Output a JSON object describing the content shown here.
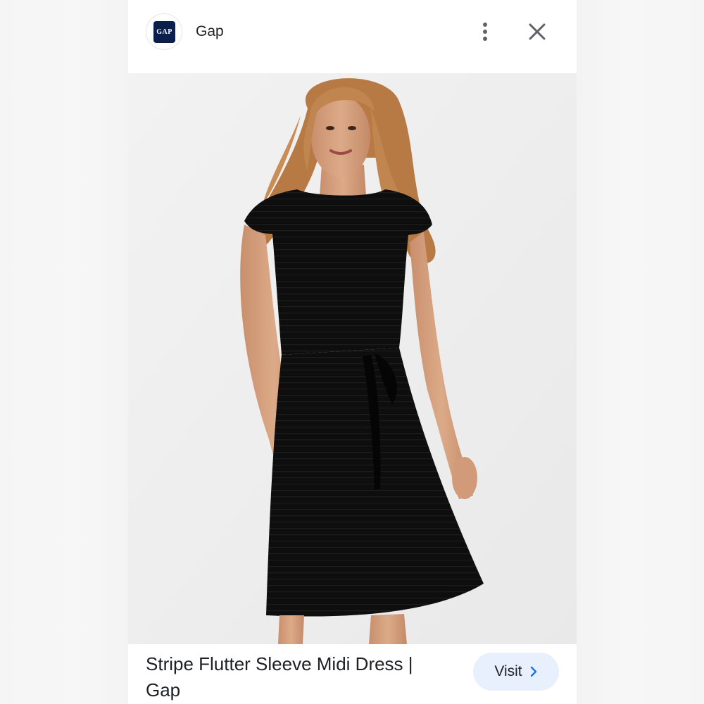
{
  "header": {
    "logo_text": "GAP",
    "site_name": "Gap",
    "more_icon": "more-vert-icon",
    "close_icon": "close-icon"
  },
  "image": {
    "alt": "Stripe Flutter Sleeve Midi Dress | Gap"
  },
  "footer": {
    "title": "Stripe Flutter Sleeve Midi Dress | Gap",
    "visit_label": "Visit",
    "visit_icon": "chevron-right-icon"
  },
  "colors": {
    "logo_bg": "#0b1f4d",
    "visit_bg": "#e8f0fe",
    "accent": "#1a73e8",
    "text": "#202124",
    "icon": "#5f6368"
  }
}
